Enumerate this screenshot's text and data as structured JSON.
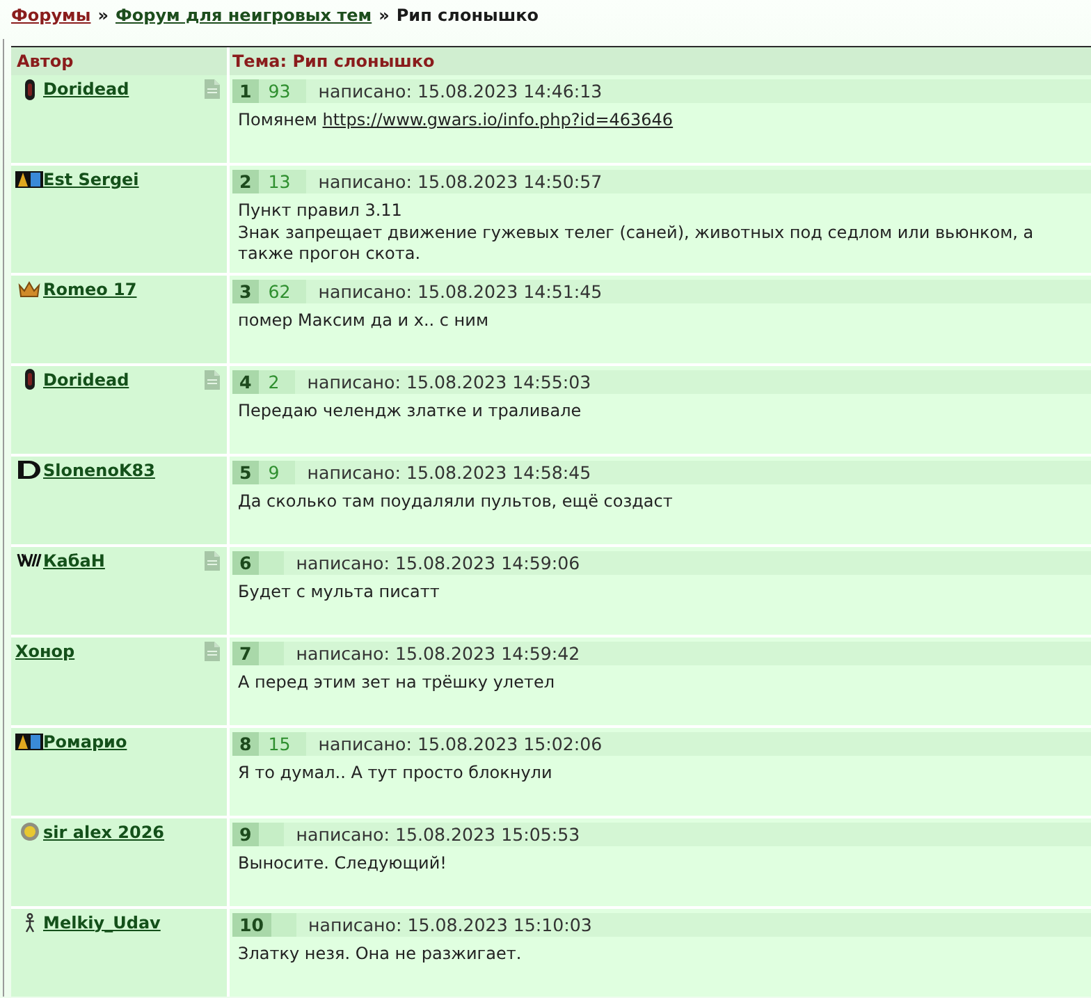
{
  "breadcrumb": [
    {
      "kind": "root_link",
      "text": "Форумы"
    },
    {
      "kind": "separator",
      "text": "»"
    },
    {
      "kind": "section_link",
      "text": "Форум для неигровых тем"
    },
    {
      "kind": "separator",
      "text": "»"
    },
    {
      "kind": "current",
      "text": "Рип слонышко"
    }
  ],
  "table": {
    "columns": [
      "Автор",
      "Тема: Рип слонышко"
    ],
    "posts": [
      {
        "author": {
          "name": "Doridead",
          "badge": {
            "kind": "capsule"
          }
        },
        "document_icon": true,
        "number": "1",
        "count": "93",
        "posted": "написано: 15.08.2023 14:46:13",
        "message": "Помянем",
        "link": "https://www.gwars.io/info.php?id=463646"
      },
      {
        "author": {
          "name": "Est Sergei",
          "badge": {
            "kind": "tag"
          }
        },
        "document_icon": false,
        "number": "2",
        "count": "13",
        "posted": "написано: 15.08.2023 14:50:57",
        "message": "Пункт правил 3.11\nЗнак запрещает движение гужевых телег (саней), животных под седлом или вьюнком, а также прогон скота."
      },
      {
        "author": {
          "name": "Romeo 17",
          "badge": {
            "kind": "crown"
          }
        },
        "document_icon": false,
        "number": "3",
        "count": "62",
        "posted": "написано: 15.08.2023 14:51:45",
        "message": "помер Максим да и х.. с ним"
      },
      {
        "author": {
          "name": "Doridead",
          "badge": {
            "kind": "capsule"
          }
        },
        "document_icon": true,
        "number": "4",
        "count": "2",
        "posted": "написано: 15.08.2023 14:55:03",
        "message": "Передаю челендж златке и траливале"
      },
      {
        "author": {
          "name": "SlonenoK83",
          "badge": {
            "kind": "dshape"
          }
        },
        "document_icon": false,
        "number": "5",
        "count": "9",
        "posted": "написано: 15.08.2023 14:58:45",
        "message": "Да сколько там поудаляли пультов, ещё создаст"
      },
      {
        "author": {
          "name": "КабаН",
          "badge": {
            "kind": "zigzag"
          }
        },
        "document_icon": true,
        "number": "6",
        "posted": "написано: 15.08.2023 14:59:06",
        "message": "Будет с мульта писатт"
      },
      {
        "author": {
          "name": "Хонор"
        },
        "document_icon": true,
        "number": "7",
        "posted": "написано: 15.08.2023 14:59:42",
        "message": "А перед этим зет на трёшку улетел"
      },
      {
        "author": {
          "name": "Ромарио",
          "badge": {
            "kind": "tag"
          }
        },
        "document_icon": false,
        "number": "8",
        "count": "15",
        "posted": "написано: 15.08.2023 15:02:06",
        "message": "Я то думал.. А тут просто блокнули"
      },
      {
        "author": {
          "name": "sir alex 2026",
          "badge": {
            "kind": "sun"
          }
        },
        "document_icon": false,
        "number": "9",
        "posted": "написано: 15.08.2023 15:05:53",
        "message": "Выносите. Следующий!"
      },
      {
        "author": {
          "name": "Melkiy_Udav",
          "badge": {
            "kind": "figure"
          }
        },
        "document_icon": false,
        "number": "10",
        "posted": "написано: 15.08.2023 15:10:03",
        "message": "Златку незя. Она не разжигает."
      }
    ]
  }
}
